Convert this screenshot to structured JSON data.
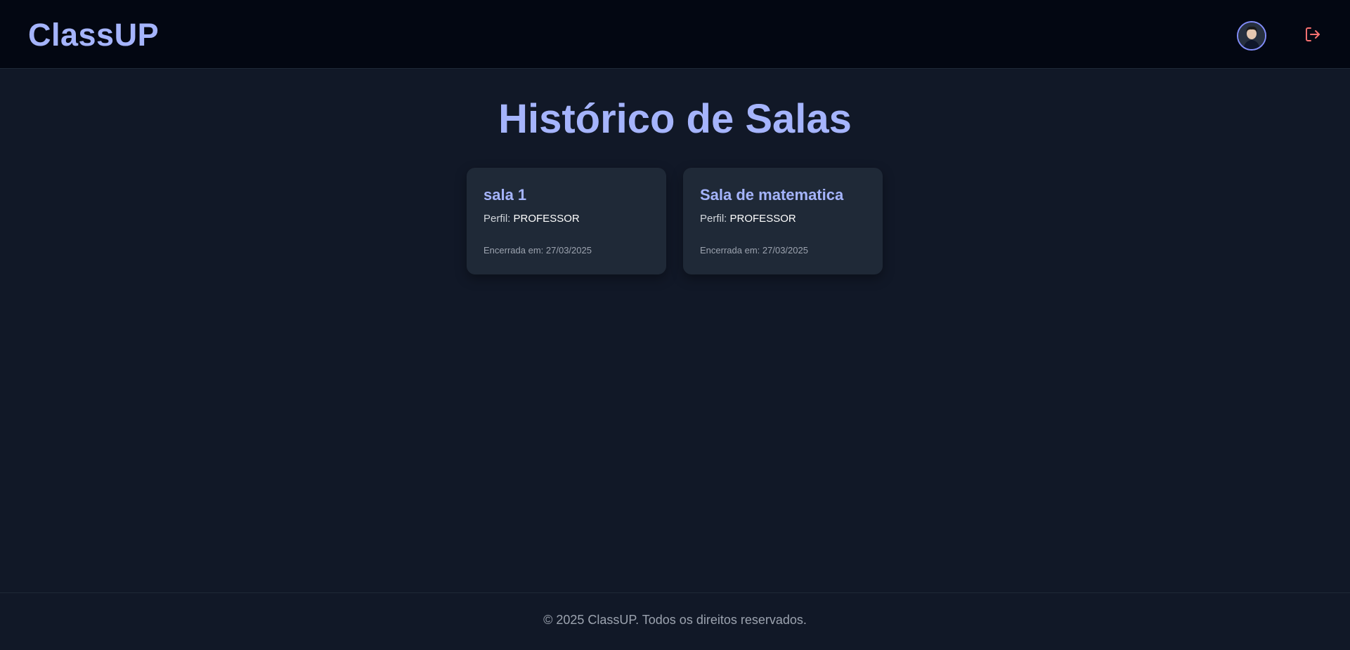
{
  "header": {
    "logo": "ClassUP",
    "avatar_icon": "user-avatar",
    "logout_icon": "logout-icon",
    "logout_color": "#f87171"
  },
  "main": {
    "title": "Histórico de Salas",
    "rooms": [
      {
        "name": "sala 1",
        "profile_label": "Perfil:",
        "profile_value": "PROFESSOR",
        "closed_label": "Encerrada em:",
        "closed_date": "27/03/2025"
      },
      {
        "name": "Sala de matematica",
        "profile_label": "Perfil:",
        "profile_value": "PROFESSOR",
        "closed_label": "Encerrada em:",
        "closed_date": "27/03/2025"
      }
    ]
  },
  "footer": {
    "text": "© 2025 ClassUP. Todos os direitos reservados."
  },
  "colors": {
    "accent": "#a5b4fc",
    "background": "#111827",
    "header_bg": "#030712",
    "card_bg": "#1f2937"
  }
}
